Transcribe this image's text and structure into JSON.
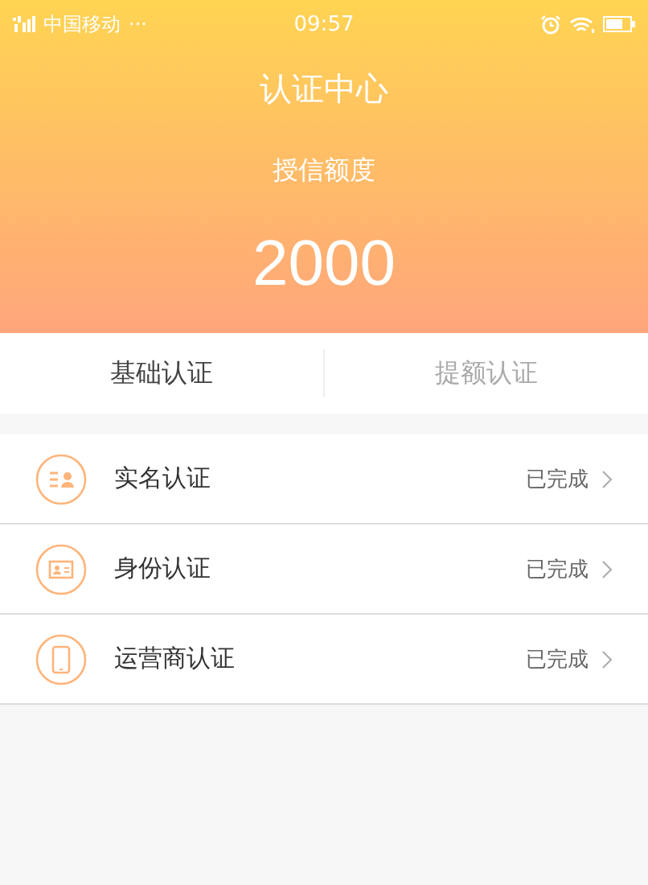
{
  "status_bar": {
    "carrier": "中国移动",
    "more": "···",
    "time": "09:57"
  },
  "header": {
    "title": "认证中心",
    "label": "授信额度",
    "amount": "2000"
  },
  "tabs": [
    {
      "label": "基础认证",
      "selected": true
    },
    {
      "label": "提额认证",
      "selected": false
    }
  ],
  "items": [
    {
      "kind": "name",
      "label": "实名认证",
      "status": "已完成"
    },
    {
      "kind": "id",
      "label": "身份认证",
      "status": "已完成"
    },
    {
      "kind": "phone",
      "label": "运营商认证",
      "status": "已完成"
    }
  ]
}
